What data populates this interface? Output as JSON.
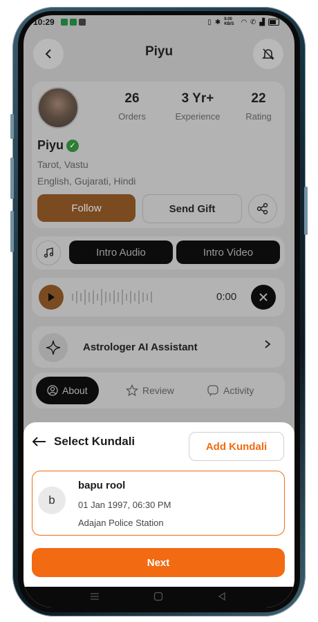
{
  "status_bar": {
    "time": "10:29",
    "app_icons": [
      "whatsapp-icon",
      "messages-icon",
      "gmail-icon"
    ],
    "right_icons": [
      "vibrate-icon",
      "bluetooth-icon",
      "speed-icon",
      "wifi-icon",
      "call-icon",
      "signal-icon",
      "battery-icon"
    ],
    "speed_label": "9.00 KB/S"
  },
  "header": {
    "title": "Piyu"
  },
  "profile": {
    "stats": [
      {
        "value": "26",
        "label": "Orders"
      },
      {
        "value": "3 Yr+",
        "label": "Experience"
      },
      {
        "value": "22",
        "label": "Rating"
      }
    ],
    "name": "Piyu",
    "skills": "Tarot, Vastu",
    "languages": "English, Gujarati, Hindi",
    "follow_label": "Follow",
    "gift_label": "Send Gift"
  },
  "media": {
    "intro_audio_label": "Intro Audio",
    "intro_video_label": "Intro Video",
    "duration": "0:00"
  },
  "assistant": {
    "label": "Astrologer AI Assistant"
  },
  "tabs": [
    {
      "label": "About",
      "icon": "user-circle-icon",
      "active": true
    },
    {
      "label": "Review",
      "icon": "star-icon",
      "active": false
    },
    {
      "label": "Activity",
      "icon": "activity-icon",
      "active": false
    }
  ],
  "sheet": {
    "title": "Select Kundali",
    "add_label": "Add Kundali",
    "kundali": {
      "initial": "b",
      "name": "bapu rool",
      "datetime": "01 Jan 1997, 06:30 PM",
      "place": "Adajan Police Station"
    },
    "next_label": "Next"
  },
  "colors": {
    "accent": "#f26a12",
    "overlay": "#a9a9a9",
    "verified": "#2f7d33"
  }
}
